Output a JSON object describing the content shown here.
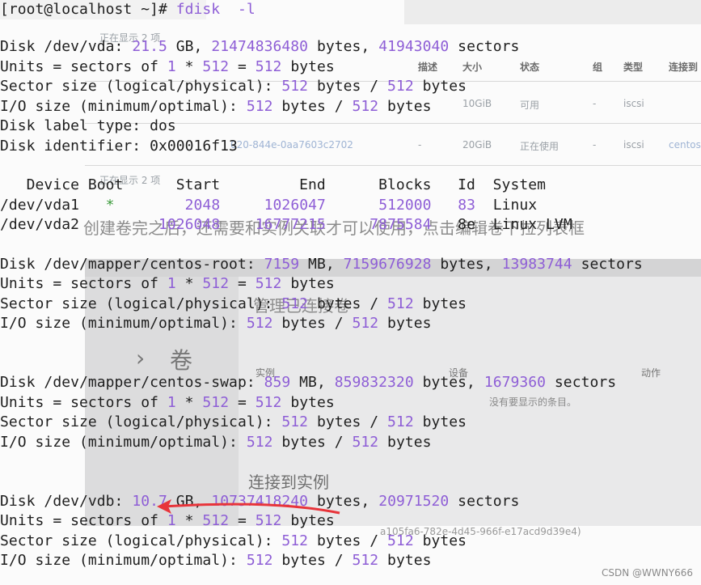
{
  "background_ui": {
    "showing_top": "正在显示 2 项",
    "col_desc": "描述",
    "col_size": "大小",
    "col_status": "状态",
    "col_group": "组",
    "col_type": "类型",
    "col_connected": "连接到",
    "row1": {
      "desc": "-",
      "size": "10GiB",
      "status": "可用",
      "group": "-",
      "type": "iscsi"
    },
    "row2": {
      "id_frag": "020-844e-0aa7603c2702",
      "desc": "-",
      "size": "20GiB",
      "status": "正在使用",
      "group": "-",
      "type": "iscsi",
      "connected": "centos"
    },
    "showing_bottom": "正在显示 2 项",
    "overlay_sentence": "创建卷完之后，还需要和实例关联才可以使用，点击编辑卷下拉列表框",
    "manage_attach": "管理已连接卷",
    "heading_volume": "卷",
    "col_instance": "实例",
    "col_device": "设备",
    "col_action": "动作",
    "no_items": "没有要显示的条目。",
    "connect_title": "连接到实例",
    "instance_id_frag": "a105fa6-782e-4d45-966f-e17acd9d39e4)",
    "watermark": "CSDN @WWNY666"
  },
  "terminal": {
    "prompt": "[root@localhost ~]# ",
    "command": "fdisk",
    "flag": "-l",
    "lines": {
      "vda_disk": [
        "Disk /dev/vda: ",
        "21.5",
        " GB, ",
        "21474836480",
        " bytes, ",
        "41943040",
        " sectors"
      ],
      "vda_units": [
        "Units = sectors of ",
        "1",
        " * ",
        "512",
        " = ",
        "512",
        " bytes"
      ],
      "vda_sector": [
        "Sector size (logical/physical): ",
        "512",
        " bytes / ",
        "512",
        " bytes"
      ],
      "vda_io": [
        "I/O size (minimum/optimal): ",
        "512",
        " bytes / ",
        "512",
        " bytes"
      ],
      "vda_label": "Disk label type: dos",
      "vda_ident": "Disk identifier: 0x00016f13",
      "part_header": "   Device Boot      Start         End      Blocks   Id  System",
      "part1": [
        "/dev/vda1   ",
        "*",
        "        ",
        "2048",
        "     ",
        "1026047",
        "      ",
        "512000",
        "   ",
        "83",
        "  Linux"
      ],
      "part2": [
        "/dev/vda2         ",
        "1026048",
        "    ",
        "16777215",
        "     ",
        "7875584",
        "   8e  Linux LVM"
      ],
      "root_disk": [
        "Disk /dev/mapper/centos-root: ",
        "7159",
        " MB, ",
        "7159676928",
        " bytes, ",
        "13983744",
        " sectors"
      ],
      "root_units": [
        "Units = sectors of ",
        "1",
        " * ",
        "512",
        " = ",
        "512",
        " bytes"
      ],
      "root_sector": [
        "Sector size (logical/physical): ",
        "512",
        " bytes / ",
        "512",
        " bytes"
      ],
      "root_io": [
        "I/O size (minimum/optimal): ",
        "512",
        " bytes / ",
        "512",
        " bytes"
      ],
      "swap_disk": [
        "Disk /dev/mapper/centos-swap: ",
        "859",
        " MB, ",
        "859832320",
        " bytes, ",
        "1679360",
        " sectors"
      ],
      "swap_units": [
        "Units = sectors of ",
        "1",
        " * ",
        "512",
        " = ",
        "512",
        " bytes"
      ],
      "swap_sector": [
        "Sector size (logical/physical): ",
        "512",
        " bytes / ",
        "512",
        " bytes"
      ],
      "swap_io": [
        "I/O size (minimum/optimal): ",
        "512",
        " bytes / ",
        "512",
        " bytes"
      ],
      "vdb_disk": [
        "Disk /dev/vdb: ",
        "10.7",
        " GB, ",
        "10737418240",
        " bytes, ",
        "20971520",
        " sectors"
      ],
      "vdb_units": [
        "Units = sectors of ",
        "1",
        " * ",
        "512",
        " = ",
        "512",
        " bytes"
      ],
      "vdb_sector": [
        "Sector size (logical/physical): ",
        "512",
        " bytes / ",
        "512",
        " bytes"
      ],
      "vdb_io": [
        "I/O size (minimum/optimal): ",
        "512",
        " bytes / ",
        "512",
        " bytes"
      ]
    }
  },
  "colors": {
    "number": "#8e5ed6",
    "arrow": "#e8343a",
    "text": "#1e1e1e"
  }
}
